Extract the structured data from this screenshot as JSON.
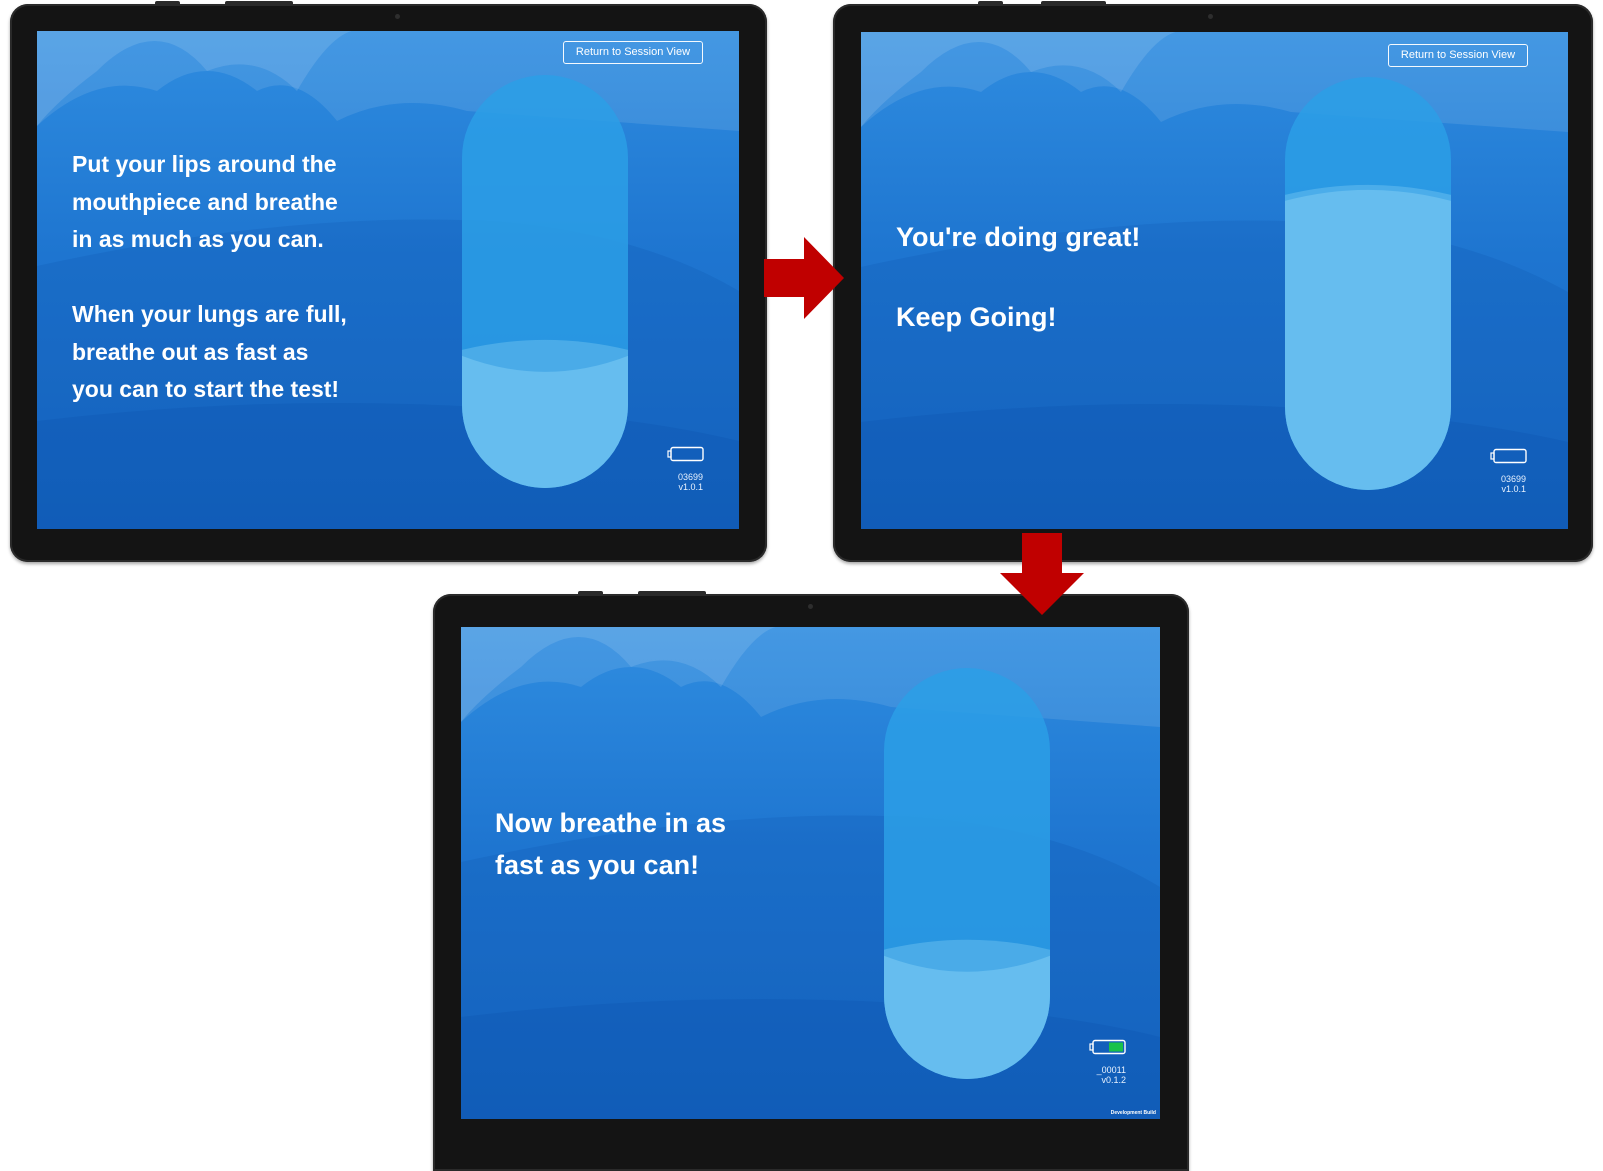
{
  "screens": [
    {
      "return_button": "Return to Session View",
      "lines": [
        "Put your lips around the",
        "mouthpiece and breathe",
        "in as much as you can.",
        "",
        "When your lungs are full,",
        "breathe out as fast as",
        "you can to start the test!"
      ],
      "device_id": "03699",
      "version": "v1.0.1",
      "fill_level": 0.32,
      "battery_level": 0
    },
    {
      "return_button": "Return to Session View",
      "lines": [
        "You're doing great!",
        "",
        "Keep Going!"
      ],
      "device_id": "03699",
      "version": "v1.0.1",
      "fill_level": 0.7,
      "battery_level": 0
    },
    {
      "lines": [
        "Now breathe in as",
        "fast as you can!"
      ],
      "device_id": "_00011",
      "version": "v0.1.2",
      "build_label": "Development Build",
      "fill_level": 0.3,
      "battery_level": 0.5
    }
  ],
  "colors": {
    "arrow": "#c00000",
    "screen_blue": "#1e75d0",
    "lung_light": "#66bdef",
    "lung_mid": "#2b9fe6",
    "battery_green": "#19c24a"
  },
  "icons": [
    "battery-icon",
    "right-arrow-icon",
    "down-arrow-icon"
  ]
}
